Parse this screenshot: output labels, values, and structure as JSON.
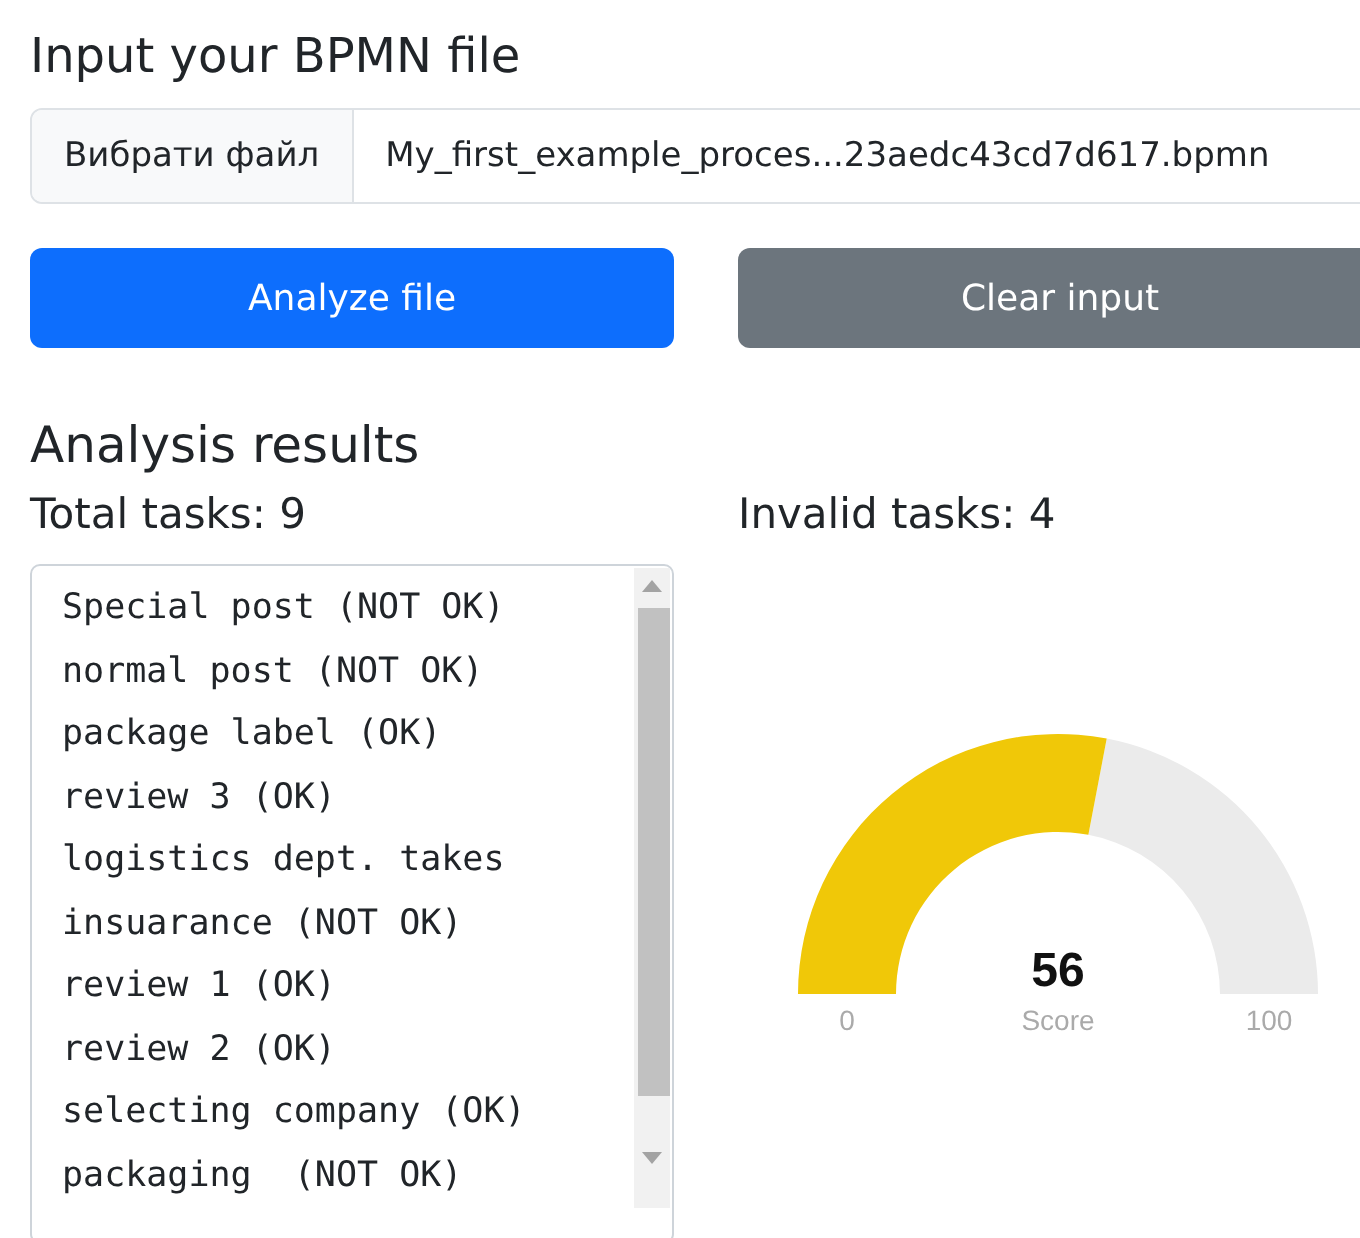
{
  "title": "Input your BPMN file",
  "file_input": {
    "button": "Вибрати файл",
    "value": "My_first_example_proces...23aedc43cd7d617.bpmn"
  },
  "buttons": [
    {
      "label": "Analyze file",
      "kind": "primary"
    },
    {
      "label": "Clear input",
      "kind": "secondary"
    }
  ],
  "results_heading": "Analysis results",
  "total_tasks": "Total tasks: 9",
  "invalid_tasks": "Invalid tasks: 4",
  "task_list": [
    "Special post (NOT OK)",
    "normal post (NOT OK)",
    "package label (OK)",
    "review 3 (OK)",
    "logistics dept. takes",
    "insuarance (NOT OK)",
    "review 1 (OK)",
    "review 2 (OK)",
    "selecting company (OK)",
    "packaging  (NOT OK)"
  ],
  "gauge": {
    "level": 0.56,
    "value": "56",
    "label": "Score",
    "min": "0",
    "max": "100"
  }
}
